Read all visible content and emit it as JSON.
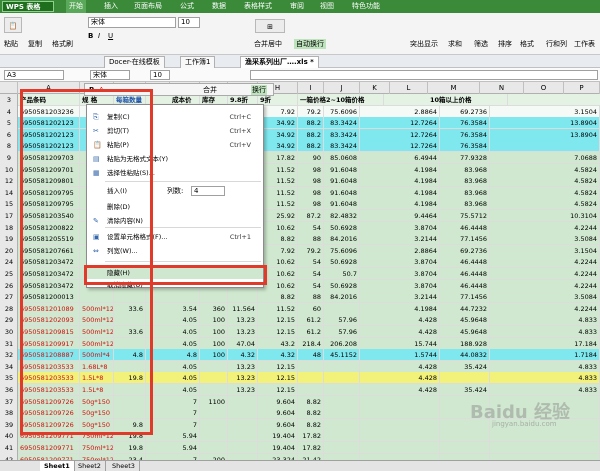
{
  "app": {
    "logo": "WPS 表格",
    "menus": [
      "开始",
      "插入",
      "页面布局",
      "公式",
      "数据",
      "表格样式",
      "审阅",
      "视图",
      "特色功能"
    ]
  },
  "ribbon": {
    "paste": "粘贴",
    "copy": "复制",
    "format_painter": "格式刷",
    "font_name": "宋体",
    "font_size": "10",
    "merge_center": "合并居中",
    "wrap_text": "自动换行",
    "highlight_dup": "突出显示",
    "sum": "求和",
    "filter": "筛选",
    "sort": "排序",
    "format": "格式",
    "row_col": "行和列",
    "worksheet": "工作表"
  },
  "doctabs": [
    "Docer-在线模板",
    "工作簿1",
    "渔采系列出厂….xls *"
  ],
  "formula": {
    "cell_ref": "A3"
  },
  "mini_toolbar": {
    "font": "宋体",
    "size": "10",
    "merge": "合并",
    "wrap": "换行"
  },
  "columns": [
    "A",
    "B",
    "C",
    "D",
    "E",
    "F",
    "G",
    "H",
    "I",
    "J",
    "K",
    "L",
    "M",
    "N",
    "O",
    "P",
    "Q"
  ],
  "header_row": {
    "row_num": "3",
    "product_code": "产品条码",
    "spec": "规 格",
    "box_qty": "每箱数量",
    "unit_price": "成本价",
    "stock": "库存",
    "disc": "9.8折",
    "h": "9折",
    "one_box": "一箱价格",
    "two_box": "2~10箱价格",
    "ten_box": "10箱以上价格"
  },
  "rows": [
    {
      "n": "4",
      "a": "6950581203236",
      "b": "",
      "c": "",
      "e": "",
      "f": "",
      "g": "",
      "h": "7.92",
      "i": "79.2",
      "j": "75.6096",
      "k": "",
      "l": "2.8864",
      "m": "69.2736",
      "n2": "3.1504",
      "color": "#f6faf6"
    },
    {
      "n": "5",
      "a": "6950581202123",
      "b": "",
      "c": "",
      "e": "",
      "f": "",
      "g": "",
      "h": "34.92",
      "i": "88.2",
      "j": "83.3424",
      "k": "",
      "l": "12.7264",
      "m": "76.3584",
      "n2": "13.8904",
      "color": "#7fe8ef"
    },
    {
      "n": "6",
      "a": "6950581202123",
      "b": "",
      "c": "",
      "e": "",
      "f": "",
      "g": "",
      "h": "34.92",
      "i": "88.2",
      "j": "83.3424",
      "k": "",
      "l": "12.7264",
      "m": "76.3584",
      "n2": "13.8904",
      "color": "#7fe8ef"
    },
    {
      "n": "8",
      "a": "6950581202123",
      "b": "",
      "c": "",
      "e": "",
      "f": "",
      "g": "",
      "h": "34.92",
      "i": "88.2",
      "j": "83.3424",
      "k": "",
      "l": "12.7264",
      "m": "76.3584",
      "n2": "",
      "color": "#7fe8ef"
    },
    {
      "n": "9",
      "a": "6950581209703",
      "b": "",
      "c": "",
      "e": "",
      "f": "",
      "g": "",
      "h": "17.82",
      "i": "90",
      "j": "85.0608",
      "k": "",
      "l": "6.4944",
      "m": "77.9328",
      "n2": "7.0688",
      "color": "#cfe8cf"
    },
    {
      "n": "10",
      "a": "6950581209701",
      "b": "",
      "c": "",
      "e": "",
      "f": "",
      "g": "",
      "h": "11.52",
      "i": "98",
      "j": "91.6048",
      "k": "",
      "l": "4.1984",
      "m": "83.968",
      "n2": "4.5824",
      "color": "#cfe8cf"
    },
    {
      "n": "12",
      "a": "6950581209801",
      "b": "",
      "c": "",
      "e": "",
      "f": "",
      "g": "",
      "h": "11.52",
      "i": "98",
      "j": "91.6048",
      "k": "",
      "l": "4.1984",
      "m": "83.968",
      "n2": "4.5824",
      "color": "#cfe8cf"
    },
    {
      "n": "14",
      "a": "6950581209795",
      "b": "",
      "c": "",
      "e": "",
      "f": "",
      "g": "",
      "h": "11.52",
      "i": "98",
      "j": "91.6048",
      "k": "",
      "l": "4.1984",
      "m": "83.968",
      "n2": "4.5824",
      "color": "#cfe8cf"
    },
    {
      "n": "15",
      "a": "6950581209795",
      "b": "",
      "c": "",
      "e": "",
      "f": "",
      "g": "",
      "h": "11.52",
      "i": "98",
      "j": "91.6048",
      "k": "",
      "l": "4.1984",
      "m": "83.968",
      "n2": "4.5824",
      "color": "#cfe8cf"
    },
    {
      "n": "17",
      "a": "6950581203540",
      "b": "",
      "c": "",
      "e": "",
      "f": "",
      "g": "",
      "h": "25.92",
      "i": "87.2",
      "j": "82.4832",
      "k": "",
      "l": "9.4464",
      "m": "75.5712",
      "n2": "10.3104",
      "color": "#cfe8cf"
    },
    {
      "n": "18",
      "a": "6950581200822",
      "b": "",
      "c": "",
      "e": "",
      "f": "",
      "g": "",
      "h": "10.62",
      "i": "54",
      "j": "50.6928",
      "k": "",
      "l": "3.8704",
      "m": "46.4448",
      "n2": "4.2244",
      "color": "#cfe8cf"
    },
    {
      "n": "19",
      "a": "6950581205519",
      "b": "",
      "c": "",
      "e": "",
      "f": "",
      "g": "",
      "h": "8.82",
      "i": "88",
      "j": "84.2016",
      "k": "",
      "l": "3.2144",
      "m": "77.1456",
      "n2": "3.5084",
      "color": "#cfe8cf"
    },
    {
      "n": "20",
      "a": "6950581207661",
      "b": "",
      "c": "",
      "e": "",
      "f": "",
      "g": "",
      "h": "7.92",
      "i": "79.2",
      "j": "75.6096",
      "k": "",
      "l": "2.8864",
      "m": "69.2736",
      "n2": "3.1504",
      "color": "#cfe8cf"
    },
    {
      "n": "24",
      "a": "6950581203472",
      "b": "",
      "c": "",
      "e": "",
      "f": "",
      "g": "",
      "h": "10.62",
      "i": "54",
      "j": "50.6928",
      "k": "",
      "l": "3.8704",
      "m": "46.4448",
      "n2": "4.2244",
      "color": "#cfe8cf"
    },
    {
      "n": "25",
      "a": "6950581203472",
      "b": "",
      "c": "",
      "e": "",
      "f": "",
      "g": "",
      "h": "10.62",
      "i": "54",
      "j": "50.7",
      "k": "",
      "l": "3.8704",
      "m": "46.4448",
      "n2": "4.2244",
      "color": "#cfe8cf"
    },
    {
      "n": "26",
      "a": "6950581203472",
      "b": "",
      "c": "",
      "e": "",
      "f": "",
      "g": "",
      "h": "10.62",
      "i": "54",
      "j": "50.6928",
      "k": "",
      "l": "3.8704",
      "m": "46.4448",
      "n2": "4.2244",
      "color": "#cfe8cf"
    },
    {
      "n": "27",
      "a": "6950581200013",
      "b": "",
      "c": "",
      "e": "",
      "f": "",
      "g": "",
      "h": "8.82",
      "i": "88",
      "j": "84.2016",
      "k": "",
      "l": "3.2144",
      "m": "77.1456",
      "n2": "3.5084",
      "color": "#cfe8cf"
    },
    {
      "n": "28",
      "a": "6950581201089",
      "b": "500ml*12",
      "c": "33.6",
      "e": "3.54",
      "f": "360",
      "g": "11.564",
      "h": "11.52",
      "i": "60",
      "j": "",
      "k": "",
      "l": "4.1984",
      "m": "44.7232",
      "n2": "4.2244",
      "color": "#cfe8cf"
    },
    {
      "n": "29",
      "a": "6950581202093",
      "b": "500ml*12",
      "c": "",
      "e": "4.05",
      "f": "100",
      "g": "13.23",
      "h": "12.15",
      "i": "61.2",
      "j": "57.96",
      "k": "",
      "l": "4.428",
      "m": "45.9648",
      "n2": "4.833",
      "color": "#cfe8cf"
    },
    {
      "n": "30",
      "a": "6950581209815",
      "b": "500ml*12",
      "c": "33.6",
      "e": "4.05",
      "f": "100",
      "g": "13.23",
      "h": "12.15",
      "i": "61.2",
      "j": "57.96",
      "k": "",
      "l": "4.428",
      "m": "45.9648",
      "n2": "4.833",
      "color": "#cfe8cf"
    },
    {
      "n": "31",
      "a": "6950581209917",
      "b": "500ml*12",
      "c": "",
      "e": "4.05",
      "f": "100",
      "g": "47.04",
      "h": "43.2",
      "i": "218.4",
      "j": "206.208",
      "k": "",
      "l": "15.744",
      "m": "188.928",
      "n2": "17.184",
      "color": "#cfe8cf"
    },
    {
      "n": "32",
      "a": "6950581208887",
      "b": "500ml*4",
      "c": "4.8",
      "e": "4.8",
      "f": "100",
      "g": "4.32",
      "h": "4.32",
      "i": "48",
      "j": "45.1152",
      "k": "",
      "l": "1.5744",
      "m": "44.0832",
      "n2": "1.7184",
      "color": "#7fe8ef"
    },
    {
      "n": "34",
      "a": "6950581203533",
      "b": "1.68L*8",
      "c": "",
      "e": "4.05",
      "f": "",
      "g": "13.23",
      "h": "12.15",
      "i": "",
      "j": "",
      "k": "",
      "l": "4.428",
      "m": "35.424",
      "n2": "4.833",
      "color": "#cfe8cf"
    },
    {
      "n": "35",
      "a": "6950581203533",
      "b": "1.5L*8",
      "c": "19.8",
      "e": "4.05",
      "f": "",
      "g": "13.23",
      "h": "12.15",
      "i": "",
      "j": "",
      "k": "",
      "l": "4.428",
      "m": "",
      "n2": "4.833",
      "color": "#f2f27a"
    },
    {
      "n": "36",
      "a": "6950581203533",
      "b": "1.5L*8",
      "c": "",
      "e": "4.05",
      "f": "",
      "g": "13.23",
      "h": "12.15",
      "i": "",
      "j": "",
      "k": "",
      "l": "4.428",
      "m": "35.424",
      "n2": "4.833",
      "color": "#cfe8cf"
    },
    {
      "n": "37",
      "a": "6950581209726",
      "b": "50g*150",
      "c": "",
      "e": "7",
      "f": "1100",
      "g": "",
      "h": "9.604",
      "i": "8.82",
      "j": "",
      "k": "",
      "l": "",
      "m": "",
      "n2": "",
      "color": "#cfe8cf"
    },
    {
      "n": "38",
      "a": "6950581209726",
      "b": "50g*150",
      "c": "",
      "e": "7",
      "f": "",
      "g": "",
      "h": "9.604",
      "i": "8.82",
      "j": "",
      "k": "",
      "l": "",
      "m": "",
      "n2": "",
      "color": "#cfe8cf"
    },
    {
      "n": "39",
      "a": "6950581209726",
      "b": "50g*150",
      "c": "9.8",
      "e": "7",
      "f": "",
      "g": "",
      "h": "9.604",
      "i": "8.82",
      "j": "",
      "k": "",
      "l": "",
      "m": "",
      "n2": "",
      "color": "#cfe8cf"
    },
    {
      "n": "40",
      "a": "6950581209771",
      "b": "750ml*12",
      "c": "19.8",
      "e": "5.94",
      "f": "",
      "g": "",
      "h": "19.404",
      "i": "17.82",
      "j": "",
      "k": "",
      "l": "",
      "m": "",
      "n2": "",
      "color": "#cfe8cf"
    },
    {
      "n": "41",
      "a": "6950581209771",
      "b": "750ml*12",
      "c": "19.8",
      "e": "5.94",
      "f": "",
      "g": "",
      "h": "19.404",
      "i": "17.82",
      "j": "",
      "k": "",
      "l": "",
      "m": "",
      "n2": "",
      "color": "#cfe8cf"
    },
    {
      "n": "42",
      "a": "6950581209771",
      "b": "750ml*12",
      "c": "23.4",
      "e": "7",
      "f": "200",
      "g": "",
      "h": "23.324",
      "i": "21.42",
      "j": "",
      "k": "",
      "l": "",
      "m": "",
      "n2": "",
      "color": "#cfe8cf"
    }
  ],
  "context_menu": {
    "items": [
      {
        "label": "复制(C)",
        "shortcut": "Ctrl+C",
        "icon": "copy-icon",
        "glyph": "⎘"
      },
      {
        "label": "剪切(T)",
        "shortcut": "Ctrl+X",
        "icon": "scissors-icon",
        "glyph": "✂"
      },
      {
        "label": "粘贴(P)",
        "shortcut": "Ctrl+V",
        "icon": "paste-icon",
        "glyph": "📋"
      },
      {
        "label": "粘贴为无格式文本(Y)",
        "shortcut": "",
        "icon": "paste-text-icon",
        "glyph": "▤"
      },
      {
        "label": "选择性粘贴(S)...",
        "shortcut": "",
        "icon": "paste-special-icon",
        "glyph": "▦"
      },
      {
        "label": "插入(I)",
        "shortcut": "",
        "icon": "insert-icon",
        "glyph": ""
      },
      {
        "label": "删除(D)",
        "shortcut": "",
        "icon": "delete-icon",
        "glyph": ""
      },
      {
        "label": "清除内容(N)",
        "shortcut": "",
        "icon": "clear-icon",
        "glyph": "✎"
      },
      {
        "label": "设置单元格格式(F)...",
        "shortcut": "Ctrl+1",
        "icon": "format-cells-icon",
        "glyph": "▣"
      },
      {
        "label": "列宽(W)...",
        "shortcut": "",
        "icon": "col-width-icon",
        "glyph": "⇔"
      },
      {
        "label": "隐藏(H)",
        "shortcut": "",
        "icon": "",
        "glyph": ""
      },
      {
        "label": "取消隐藏(U)",
        "shortcut": "",
        "icon": "",
        "glyph": ""
      }
    ],
    "col_count_label": "列数:",
    "col_count_value": "4"
  },
  "sheets": [
    "Sheet1",
    "Sheet2",
    "Sheet3"
  ],
  "watermark": {
    "brand": "Baidu 经验",
    "url": "jingyan.baidu.com"
  },
  "colors": {
    "highlight": "#e03a2a",
    "brand_green": "#3a8a3a",
    "cyan_row": "#7fe8ef",
    "yellow_row": "#f2f27a",
    "red_text": "#d01010"
  }
}
